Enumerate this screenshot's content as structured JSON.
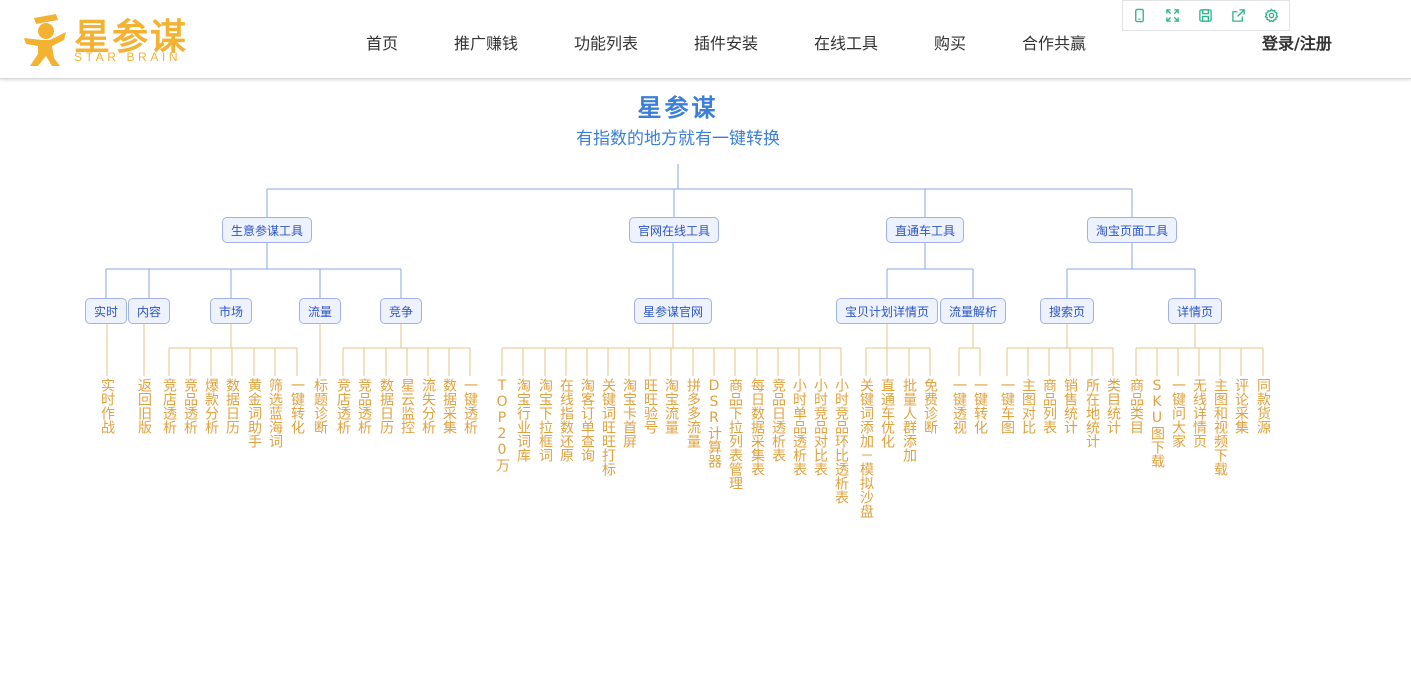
{
  "header": {
    "logo": {
      "title": "星参谋",
      "subtitle": "STAR BRAIN",
      "brand_color": "#f4b233"
    },
    "nav": [
      "首页",
      "推广赚钱",
      "功能列表",
      "插件安装",
      "在线工具",
      "购买",
      "合作共赢"
    ],
    "login_label": "登录/注册",
    "toolbar_icons": [
      "mobile-icon",
      "fullscreen-icon",
      "save-icon",
      "share-icon",
      "settings-icon"
    ]
  },
  "mindmap": {
    "title": "星参谋",
    "subtitle": "有指数的地方就有一键转换",
    "accent_color": "#3b7fd8",
    "leaf_color": "#e0a23f",
    "branches": [
      {
        "label": "生意参谋工具",
        "children": [
          {
            "label": "实时",
            "leaves": [
              "实时作战"
            ]
          },
          {
            "label": "内容",
            "leaves": [
              "返回旧版"
            ]
          },
          {
            "label": "市场",
            "leaves": [
              "竞店透析",
              "竞品透析",
              "爆款分析",
              "数据日历",
              "黄金词助手",
              "筛选蓝海词",
              "一键转化"
            ]
          },
          {
            "label": "流量",
            "leaves": [
              "标题诊断"
            ]
          },
          {
            "label": "竞争",
            "leaves": [
              "竞店透析",
              "竞品透析",
              "数据日历",
              "星云监控",
              "流失分析",
              "数据采集",
              "一键透析"
            ]
          }
        ]
      },
      {
        "label": "官网在线工具",
        "children": [
          {
            "label": "星参谋官网",
            "leaves": [
              "TOP20万",
              "淘宝行业词库",
              "淘宝下拉框词",
              "在线指数还原",
              "淘客订单查询",
              "关键词旺旺打标",
              "淘宝卡首屏",
              "旺旺验号",
              "淘宝流量",
              "拼多多流量",
              "DSR计算器",
              "商品下拉列表管理",
              "每日数据采集表",
              "竞品日透析表",
              "小时单品透析表",
              "小时竞品对比表",
              "小时竞品环比透析表"
            ]
          }
        ]
      },
      {
        "label": "直通车工具",
        "children": [
          {
            "label": "宝贝计划详情页",
            "leaves": [
              "关键词添加－模拟沙盘",
              "直通车优化",
              "批量人群添加",
              "免费诊断"
            ]
          },
          {
            "label": "流量解析",
            "leaves": [
              "一键透视",
              "一键转化"
            ]
          }
        ]
      },
      {
        "label": "淘宝页面工具",
        "children": [
          {
            "label": "搜索页",
            "leaves": [
              "一键车图",
              "主图对比",
              "商品列表",
              "销售统计",
              "所在地统计",
              "类目统计"
            ]
          },
          {
            "label": "详情页",
            "leaves": [
              "商品类目",
              "SKU图下载",
              "一键问大家",
              "无线详情页",
              "主图和视频下载",
              "评论采集",
              "同款货源"
            ]
          }
        ]
      }
    ]
  }
}
